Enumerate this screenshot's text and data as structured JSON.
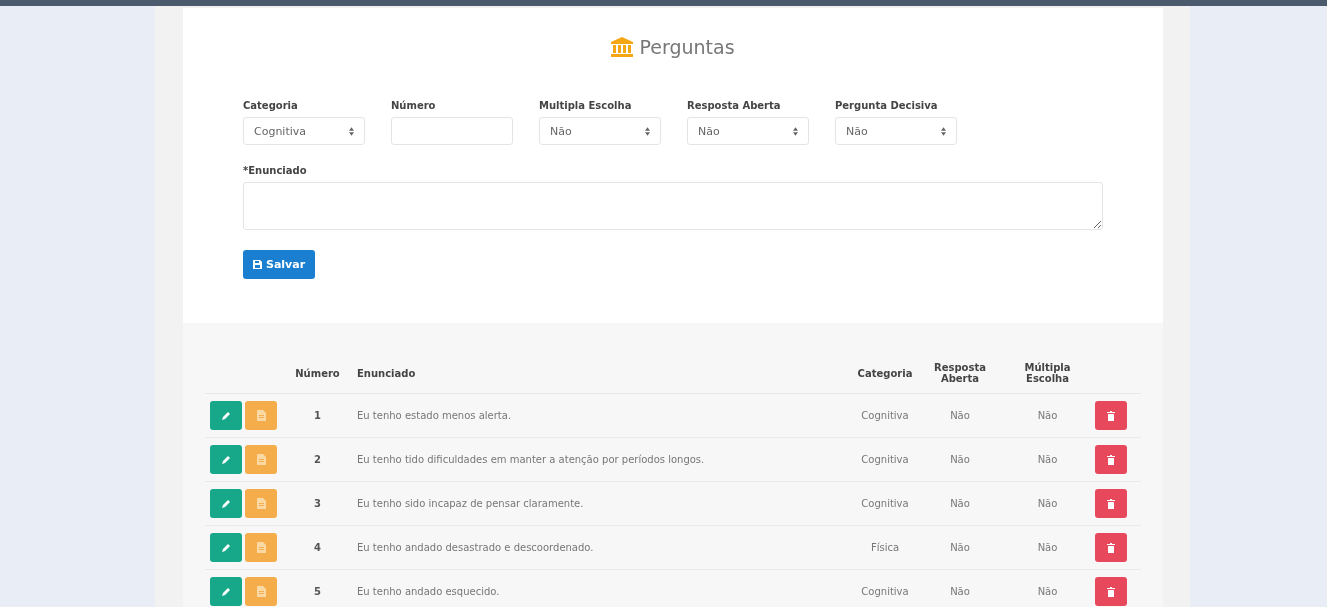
{
  "page_title": "Perguntas",
  "form": {
    "fields": [
      {
        "label": "Categoria",
        "kind": "select",
        "value": "Cognitiva"
      },
      {
        "label": "Número",
        "kind": "input"
      },
      {
        "label": "Multipla Escolha",
        "kind": "select",
        "value": "Não"
      },
      {
        "label": "Resposta Aberta",
        "kind": "select",
        "value": "Não"
      },
      {
        "label": "Pergunta Decisiva",
        "kind": "select",
        "value": "Não"
      }
    ],
    "statement_label": "*Enunciado",
    "save_button": "Salvar"
  },
  "table": {
    "columns": [
      "Número",
      "Enunciado",
      "Categoria",
      "Resposta Aberta",
      "Múltipla Escolha"
    ],
    "rows": [
      {
        "numero": "1",
        "enunciado": "Eu tenho estado menos alerta.",
        "categoria": "Cognitiva",
        "resposta_aberta": "Não",
        "multipla_escolha": "Não"
      },
      {
        "numero": "2",
        "enunciado": "Eu tenho tido dificuldades em manter a atenção por períodos longos.",
        "categoria": "Cognitiva",
        "resposta_aberta": "Não",
        "multipla_escolha": "Não"
      },
      {
        "numero": "3",
        "enunciado": "Eu tenho sido incapaz de pensar claramente.",
        "categoria": "Cognitiva",
        "resposta_aberta": "Não",
        "multipla_escolha": "Não"
      },
      {
        "numero": "4",
        "enunciado": "Eu tenho andado desastrado e descoordenado.",
        "categoria": "Física",
        "resposta_aberta": "Não",
        "multipla_escolha": "Não"
      },
      {
        "numero": "5",
        "enunciado": "Eu tenho andado esquecido.",
        "categoria": "Cognitiva",
        "resposta_aberta": "Não",
        "multipla_escolha": "Não"
      }
    ]
  }
}
